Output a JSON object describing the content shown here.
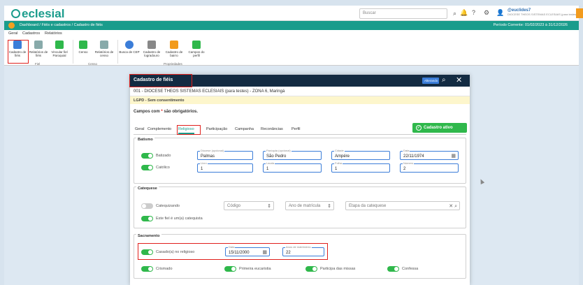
{
  "app": {
    "logo": "eclesial"
  },
  "topbar": {
    "search_placeholder": "Buscar",
    "user_name": "@euclides7",
    "user_sub": "DIOCESE THEOS SISTEMAS ECLESIAIS (para testes)"
  },
  "navbar": {
    "breadcrumb": "Dashboard / Fiéis e cadastros / Cadastro de fiéis",
    "periodo": "Período Corrente: 01/02/2023 à 31/12/2026"
  },
  "menu_tabs": [
    "Geral",
    "Cadastros",
    "Relatórios"
  ],
  "ribbon": {
    "buttons": [
      "Cadastro de fiéis",
      "Relatórios de fiéis",
      "Vincular fiel Paroquial",
      "Censo",
      "Relatórios de censo",
      "Busca de CEP",
      "Cadastro de logradouro",
      "Cadastro de bairro",
      "Campos do perfil"
    ],
    "groups": [
      "Fiel",
      "Censo",
      "Propriedades"
    ]
  },
  "modal": {
    "title": "Cadastro de fiéis",
    "status_badge": "Alterando",
    "org": "001 - DIOCESE THEOS SISTEMAS ECLESIAIS (para testes) - ZONA 6, Maringá",
    "lgpd": "LGPD - Sem consentimento",
    "required_prefix": "Campos com",
    "required_star": "*",
    "required_suffix": "são obrigatórios.",
    "tabs": [
      "Geral",
      "Complemento",
      "Religioso",
      "Participação",
      "Campanha",
      "Reconâncias",
      "Perfil"
    ],
    "active_button": "Cadastro ativo"
  },
  "batismo": {
    "title": "Batismo",
    "toggle1": "Batizado",
    "toggle2": "Católico",
    "diocese_label": "Diocese (opcional)",
    "diocese_value": "Palmas",
    "paroquia_label": "Paróquia (opcional)",
    "paroquia_value": "São Pedro",
    "cidade_label": "Cidade",
    "cidade_value": "Ampére",
    "data_label": "Data",
    "data_value": "22/11/1974",
    "livro_label": "Livro",
    "livro_value": "1",
    "lauda_label": "Lauda",
    "lauda_value": "1",
    "folha_label": "Folha",
    "folha_value": "1",
    "numero_label": "Número",
    "numero_value": "2"
  },
  "catequese": {
    "title": "Catequese",
    "toggle1": "Catequizando",
    "codigo": "Código",
    "ano": "Ano de matrícula",
    "etapa": "Etapa da catequese",
    "toggle2": "Este fiel é um(a) catequista"
  },
  "sacramento": {
    "title": "Sacramento",
    "casado": "Casado(a) no religioso",
    "data_label": "Data",
    "data_value": "15/11/2000",
    "anos_label": "Anos de matrimônio",
    "anos_value": "22",
    "crismado": "Crismado",
    "eucaristia": "Primeira eucaristia",
    "missas": "Participa das missas",
    "confessa": "Confessa"
  }
}
